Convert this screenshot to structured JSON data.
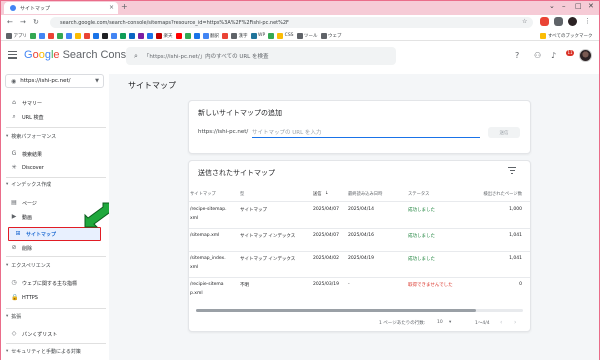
{
  "browser": {
    "tab_title": "サイトマップ",
    "tab_close": "×",
    "new_tab": "+",
    "url": "search.google.com/search-console/sitemaps?resource_id=https%3A%2F%2Fishi-pc.net%2F",
    "bookmarks": [
      {
        "label": "アプリ",
        "color": "#5f6368"
      },
      {
        "label": "",
        "color": "#34a853"
      },
      {
        "label": "",
        "color": "#4285f4"
      },
      {
        "label": "",
        "color": "#ea4335"
      },
      {
        "label": "",
        "color": "#34a853"
      },
      {
        "label": "",
        "color": "#4285f4"
      },
      {
        "label": "",
        "color": "#fbbc04"
      },
      {
        "label": "",
        "color": "#ea4335"
      },
      {
        "label": "",
        "color": "#1a73e8"
      },
      {
        "label": "",
        "color": "#202124"
      },
      {
        "label": "",
        "color": "#4285f4"
      },
      {
        "label": "",
        "color": "#0f9d58"
      },
      {
        "label": "",
        "color": "#0a66c2"
      },
      {
        "label": "",
        "color": "#7b1fa2"
      },
      {
        "label": "",
        "color": "#1a73e8"
      },
      {
        "label": "楽天",
        "color": "#bf0000"
      },
      {
        "label": "",
        "color": "#ff0000"
      },
      {
        "label": "",
        "color": "#34a853"
      },
      {
        "label": "",
        "color": "#1a73e8"
      },
      {
        "label": "翻訳",
        "color": "#4285f4"
      },
      {
        "label": "",
        "color": "#ea4335"
      },
      {
        "label": "漢字",
        "color": "#5f6368"
      },
      {
        "label": "WP",
        "color": "#21759b"
      },
      {
        "label": "",
        "color": "#34a853"
      },
      {
        "label": "CSS",
        "color": "#fbbc04"
      },
      {
        "label": "ツール",
        "color": "#5f6368"
      },
      {
        "label": "ウェブ",
        "color": "#5f6368"
      }
    ],
    "all_bookmarks": "すべてのブックマーク"
  },
  "header": {
    "logo_google": "Google",
    "logo_product": "Search Console",
    "search_placeholder": "「https://ishi-pc.net/」内のすべての URL を検査",
    "notif_count": "11"
  },
  "sidebar": {
    "property": "https://ishi-pc.net/",
    "items_top": [
      {
        "label": "サマリー",
        "icon": "⌂",
        "name": "sidebar-item-summary"
      },
      {
        "label": "URL 検査",
        "icon": "⌕",
        "name": "sidebar-item-url-inspection"
      }
    ],
    "sections": [
      {
        "label": "検索パフォーマンス",
        "items": [
          {
            "label": "検索結果",
            "icon": "G",
            "name": "sidebar-item-search-results"
          },
          {
            "label": "Discover",
            "icon": "✳",
            "name": "sidebar-item-discover"
          }
        ]
      },
      {
        "label": "インデックス作成",
        "items": [
          {
            "label": "ページ",
            "icon": "▤",
            "name": "sidebar-item-pages"
          },
          {
            "label": "動画",
            "icon": "▶",
            "name": "sidebar-item-videos"
          },
          {
            "label": "サイトマップ",
            "icon": "⊞",
            "name": "sidebar-item-sitemaps"
          },
          {
            "label": "削除",
            "icon": "⊘",
            "name": "sidebar-item-removals"
          }
        ]
      },
      {
        "label": "エクスペリエンス",
        "items": [
          {
            "label": "ウェブに関する主な指標",
            "icon": "◷",
            "name": "sidebar-item-core-web-vitals"
          },
          {
            "label": "HTTPS",
            "icon": "🔒",
            "name": "sidebar-item-https"
          }
        ]
      },
      {
        "label": "拡張",
        "items": [
          {
            "label": "パンくずリスト",
            "icon": "◇",
            "name": "sidebar-item-breadcrumbs"
          }
        ]
      },
      {
        "label": "セキュリティと手動による対策",
        "items": []
      }
    ]
  },
  "main": {
    "page_title": "サイトマップ",
    "add_card": {
      "title": "新しいサイトマップの追加",
      "prefix": "https://ishi-pc.net/",
      "input_placeholder": "サイトマップの URL を入力",
      "submit": "送信"
    },
    "submitted": {
      "title": "送信されたサイトマップ",
      "columns": [
        "サイトマップ",
        "型",
        "送信",
        "最終読み込み日時",
        "ステータス",
        "検出されたページ数"
      ],
      "rows": [
        {
          "sitemap": [
            "/recipe-sitemap.",
            "xml"
          ],
          "type": "サイトマップ",
          "submitted": "2025/04/07",
          "last_read": "2025/04/14",
          "status": "成功しました",
          "status_kind": "ok",
          "pages": "1,000"
        },
        {
          "sitemap": [
            "/sitemap.xml"
          ],
          "type": "サイトマップ インデックス",
          "submitted": "2025/04/07",
          "last_read": "2025/04/16",
          "status": "成功しました",
          "status_kind": "ok",
          "pages": "1,041"
        },
        {
          "sitemap": [
            "/sitemap_index.",
            "xml"
          ],
          "type": "サイトマップ インデックス",
          "submitted": "2025/04/02",
          "last_read": "2025/04/19",
          "status": "成功しました",
          "status_kind": "ok",
          "pages": "1,041"
        },
        {
          "sitemap": [
            "/recipie-sitema",
            "p.xml"
          ],
          "type": "不明",
          "submitted": "2025/03/19",
          "last_read": "-",
          "status": "取得できませんでした",
          "status_kind": "ng",
          "pages": "0"
        }
      ],
      "pager": {
        "rows_per_page_label": "1 ページあたりの行数:",
        "rows_per_page": "10",
        "range": "1～4/4"
      }
    }
  },
  "colors": {
    "accent": "#1a73e8",
    "success": "#188038",
    "error": "#d93025",
    "highlight_border": "#e11d25",
    "arrow": "#1fa83c",
    "window_frame": "#ea6d8a"
  }
}
